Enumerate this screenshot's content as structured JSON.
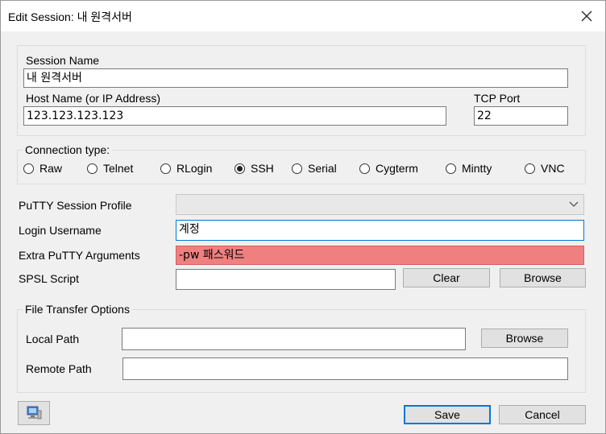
{
  "window": {
    "title": "Edit Session: 내 원격서버"
  },
  "session": {
    "name_label": "Session Name",
    "name_value": "내 원격서버",
    "host_label": "Host Name (or IP Address)",
    "host_value": "123.123.123.123",
    "port_label": "TCP Port",
    "port_value": "22"
  },
  "connection": {
    "label": "Connection type:",
    "options": [
      {
        "label": "Raw",
        "selected": false
      },
      {
        "label": "Telnet",
        "selected": false
      },
      {
        "label": "RLogin",
        "selected": false
      },
      {
        "label": "SSH",
        "selected": true
      },
      {
        "label": "Serial",
        "selected": false
      },
      {
        "label": "Cygterm",
        "selected": false
      },
      {
        "label": "Mintty",
        "selected": false
      },
      {
        "label": "VNC",
        "selected": false
      }
    ]
  },
  "profile": {
    "label": "PuTTY Session Profile",
    "value": ""
  },
  "login": {
    "label": "Login Username",
    "value": "계정"
  },
  "extra": {
    "label": "Extra PuTTY Arguments",
    "value": "-pw 패스워드",
    "highlight_color": "#f08080"
  },
  "spsl": {
    "label": "SPSL Script",
    "value": "",
    "clear_label": "Clear",
    "browse_label": "Browse"
  },
  "transfer": {
    "label": "File Transfer Options",
    "local_label": "Local Path",
    "local_value": "",
    "local_browse_label": "Browse",
    "remote_label": "Remote Path",
    "remote_value": ""
  },
  "footer": {
    "save_label": "Save",
    "cancel_label": "Cancel"
  },
  "colors": {
    "accent": "#0078d7"
  }
}
